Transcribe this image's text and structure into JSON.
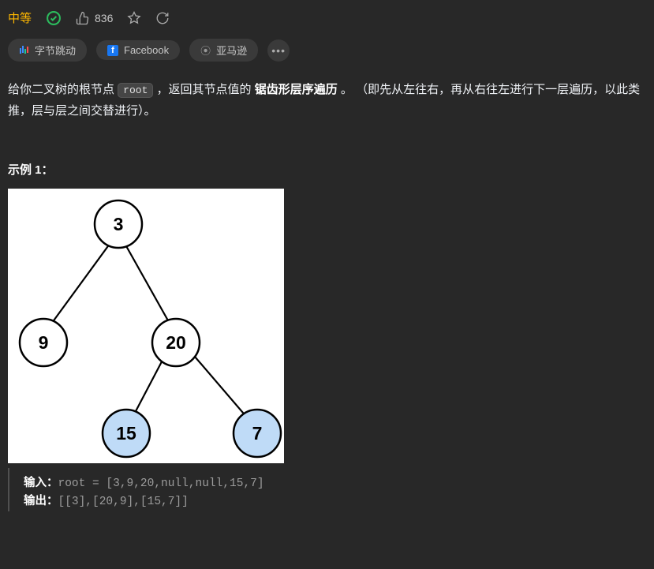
{
  "header": {
    "difficulty": "中等",
    "likes": "836"
  },
  "tags": {
    "bytedance": "字节跳动",
    "facebook": "Facebook",
    "amazon": "亚马逊"
  },
  "description": {
    "pre": "给你二叉树的根节点 ",
    "code": "root",
    "mid1": " ，返回其节点值的 ",
    "bold": "锯齿形层序遍历",
    "mid2": " 。 （即先从左往右，再从右往左进行下一层遍历，以此类推，层与层之间交替进行）。"
  },
  "example": {
    "heading": "示例 1：",
    "tree": {
      "root": "3",
      "l": "9",
      "r": "20",
      "rl": "15",
      "rr": "7"
    },
    "input_label": "输入：",
    "input_val": "root = [3,9,20,null,null,15,7]",
    "output_label": "输出：",
    "output_val": "[[3],[20,9],[15,7]]"
  }
}
